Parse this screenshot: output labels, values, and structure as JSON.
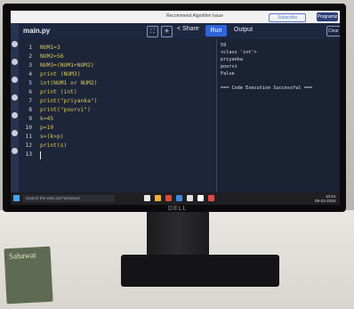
{
  "browser": {
    "ad_text": "Recommend Algorithm Issue",
    "button_outline": "Subscribe",
    "button_primary": "Programiz PRO"
  },
  "header": {
    "file_tab": "main.py",
    "share_label": "Share",
    "run_label": "Run",
    "output_title": "Output",
    "clear_label": "Clear"
  },
  "editor": {
    "lines": [
      {
        "n": "1",
        "code": "NUM1=3"
      },
      {
        "n": "2",
        "code": "NUM2=56"
      },
      {
        "n": "3",
        "code": "NUM3=(NUM1+NUM2)"
      },
      {
        "n": "4",
        "code": "print (NUM3)"
      },
      {
        "n": "5",
        "code": "int(NUM1 or NUM2)"
      },
      {
        "n": "6",
        "code": "print (int)"
      },
      {
        "n": "7",
        "code": "print(\"priyanka\")"
      },
      {
        "n": "8",
        "code": "print(\"poorvi\")"
      },
      {
        "n": "9",
        "code": "k=45"
      },
      {
        "n": "10",
        "code": "p=10"
      },
      {
        "n": "11",
        "code": "s=(k>p)"
      },
      {
        "n": "12",
        "code": "print(s)"
      },
      {
        "n": "13",
        "code": ""
      }
    ]
  },
  "output": {
    "lines": [
      "59",
      "<class 'int'>",
      "priyanka",
      "poorvi",
      "False",
      "",
      "=== Code Execution Successful ==="
    ]
  },
  "taskbar": {
    "search_placeholder": "Search the web and Windows",
    "time": "10:51",
    "date": "09-02-2024"
  },
  "monitor": {
    "brand": "DELL"
  },
  "book": {
    "text": "Sahawat"
  }
}
